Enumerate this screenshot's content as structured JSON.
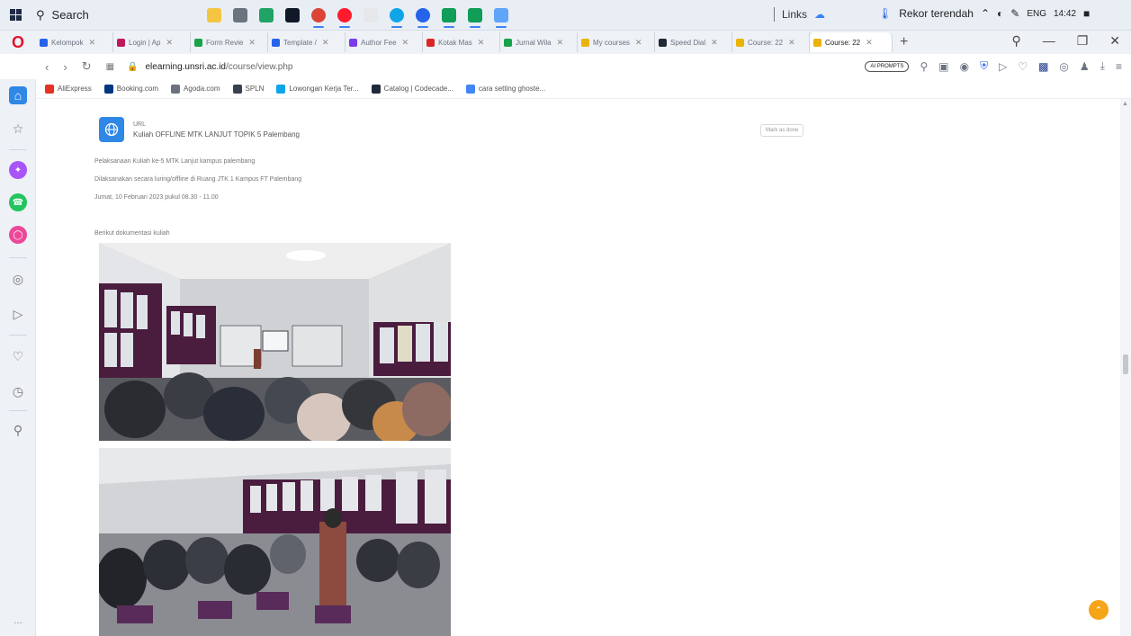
{
  "taskbar": {
    "search_label": "Search",
    "links_label": "Links",
    "weather_label": "Rekor terendah",
    "lang": "ENG",
    "time": "14:42"
  },
  "tabs": [
    {
      "label": "Kelompok",
      "color": "#2563eb"
    },
    {
      "label": "Login | Ap",
      "color": "#be185d"
    },
    {
      "label": "Form Revie",
      "color": "#16a34a"
    },
    {
      "label": "Template /",
      "color": "#2563eb"
    },
    {
      "label": "Author Fee",
      "color": "#7c3aed"
    },
    {
      "label": "Kotak Mas",
      "color": "#dc2626"
    },
    {
      "label": "Jurnal Wila",
      "color": "#16a34a"
    },
    {
      "label": "My courses",
      "color": "#eab308"
    },
    {
      "label": "Speed Dial",
      "color": "#1f2937"
    },
    {
      "label": "Course: 22",
      "color": "#eab308"
    },
    {
      "label": "Course: 22",
      "color": "#eab308",
      "active": true
    }
  ],
  "address": {
    "url_domain": "elearning.unsri.ac.id",
    "url_path": "/course/view.php",
    "ai_label": "AI PROMPTS"
  },
  "bookmarks": [
    {
      "label": "AliExpress",
      "color": "#e43225"
    },
    {
      "label": "Booking.com",
      "color": "#003580"
    },
    {
      "label": "Agoda.com",
      "color": "#6b7280"
    },
    {
      "label": "SPLN",
      "color": "#374151"
    },
    {
      "label": "Lowongan Kerja Ter...",
      "color": "#0ea5e9"
    },
    {
      "label": "Catalog | Codecade...",
      "color": "#1f2937"
    },
    {
      "label": "cara setting ghoste...",
      "color": "#4285f4"
    }
  ],
  "activity": {
    "type": "URL",
    "title": "Kuliah OFFLINE MTK LANJUT TOPIK 5 Palembang",
    "mark_done": "Mark as done"
  },
  "description": {
    "line1": "Pelaksanaan Kuliah ke-5 MTK Lanjut kampus palembang",
    "line2": "Dilaksanakan secara luring/offline di Ruang JTK 1 Kampus FT Palembang",
    "line3": "Jumat, 10 Februari 2023 pukul 08.30 - 11.00",
    "line4": "Berikut dokumentasi kuliah"
  },
  "colors": {
    "accent_blue": "#2f87e6",
    "scroll_top_button": "#f6a418"
  }
}
